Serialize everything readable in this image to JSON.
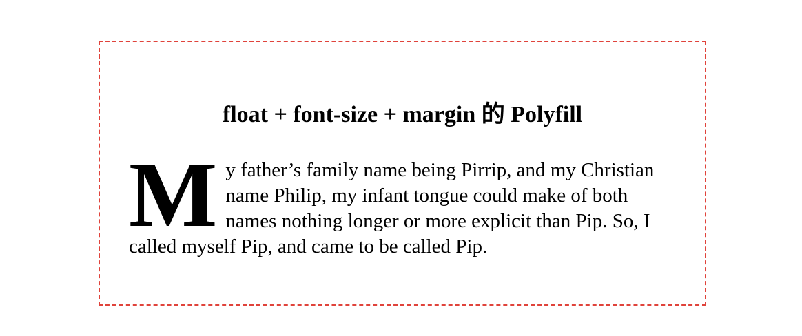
{
  "page": {
    "title": "float + font-size + margin 的 Polyfill"
  },
  "paragraph": {
    "drop_cap": "M",
    "text": "y father’s family name being Pirrip, and my Christian name Philip, my infant tongue could make of both names nothing longer or more explicit than Pip. So, I called myself Pip, and came to be called Pip."
  },
  "colors": {
    "frame_border": "#e0433b",
    "text": "#000000",
    "background": "#ffffff"
  }
}
